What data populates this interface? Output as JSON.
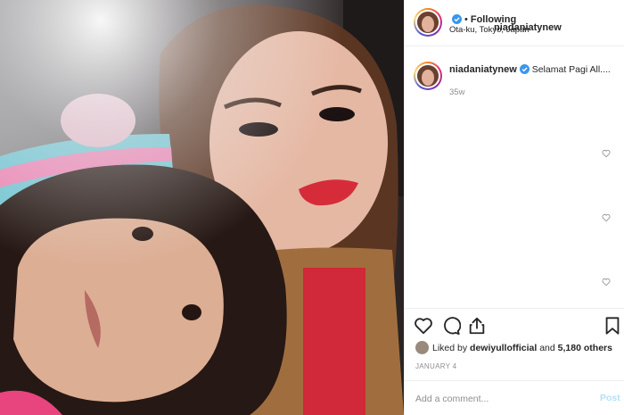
{
  "post": {
    "username": "niadaniatynew",
    "verified": true,
    "separator": "•",
    "follow_status": "Following",
    "location": "Ota-ku, Tokyo, Japan",
    "photo_alt": "Selfie of a woman and a child"
  },
  "caption": {
    "username": "niadaniatynew",
    "text": "Selamat Pagi All....",
    "age": "35w"
  },
  "likes": {
    "prefix": "Liked by",
    "liker": "dewiyullofficial",
    "conjunction": "and",
    "others": "5,180 others"
  },
  "date": "JANUARY 4",
  "comment_box": {
    "placeholder": "Add a comment...",
    "post_label": "Post"
  },
  "icons": {
    "verified": "verified-badge-icon",
    "like": "heart-icon",
    "comment": "comment-bubble-icon",
    "share": "share-icon",
    "save": "bookmark-icon"
  },
  "colors": {
    "accent": "#3897f0",
    "post_disabled": "#b2dffc",
    "muted_text": "#8e8e8e",
    "border": "#efefef"
  }
}
